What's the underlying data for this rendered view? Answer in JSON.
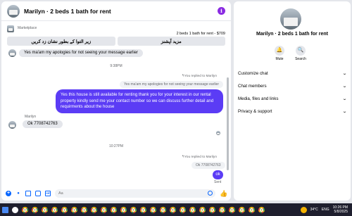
{
  "header": {
    "title": "Marilyn · 2 beds 1 bath for rent"
  },
  "listing": {
    "label": "Marketplace",
    "info": "2 beds 1 bath for rent - $709",
    "quick_replies": [
      "زیر التوا کے بطور نشان زد کریں",
      "مزید آپشنز"
    ]
  },
  "messages": {
    "apology_1": "Yes ma'am my apologies for not seeing your message earlier",
    "time_1": "9:38PM",
    "reply_note_1": "You replied to Marilyn",
    "quoted_1": "Yes ma'am my apologies for not seeing your message earlier",
    "long_out": "Yes this house is still available for renting thank you for your interest in our rental property kindly send me your contact number so we can discuss further detail and requirments about the house",
    "sender": "Marilyn",
    "phone_in": "Ok 7708742763",
    "time_2": "10:27PM",
    "reply_note_2": "You replied to Marilyn",
    "quoted_2": "Ok 7708742763",
    "ok_out": "ok",
    "sent": "Sent"
  },
  "composer": {
    "placeholder": "Aa"
  },
  "info_pane": {
    "title": "Marilyn · 2 beds 1 bath for rent",
    "mute_label": "Mute",
    "search_label": "Search",
    "sections": [
      "Customize chat",
      "Chat members",
      "Media, files and links",
      "Privacy & support"
    ]
  },
  "taskbar": {
    "temperature": "34°C",
    "language": "ENG",
    "time": "10:26 PM",
    "date": "5/8/2025"
  },
  "colors": {
    "accent": "#0866ff",
    "bubble_out": "#5b3cf5",
    "info_icon": "#8a2be2"
  },
  "icons": [
    "info-icon",
    "plus-icon",
    "mic-icon",
    "image-icon",
    "sticker-icon",
    "gif-icon",
    "emoji-icon",
    "like-icon",
    "bell-icon",
    "search-icon",
    "chevron-down-icon"
  ]
}
